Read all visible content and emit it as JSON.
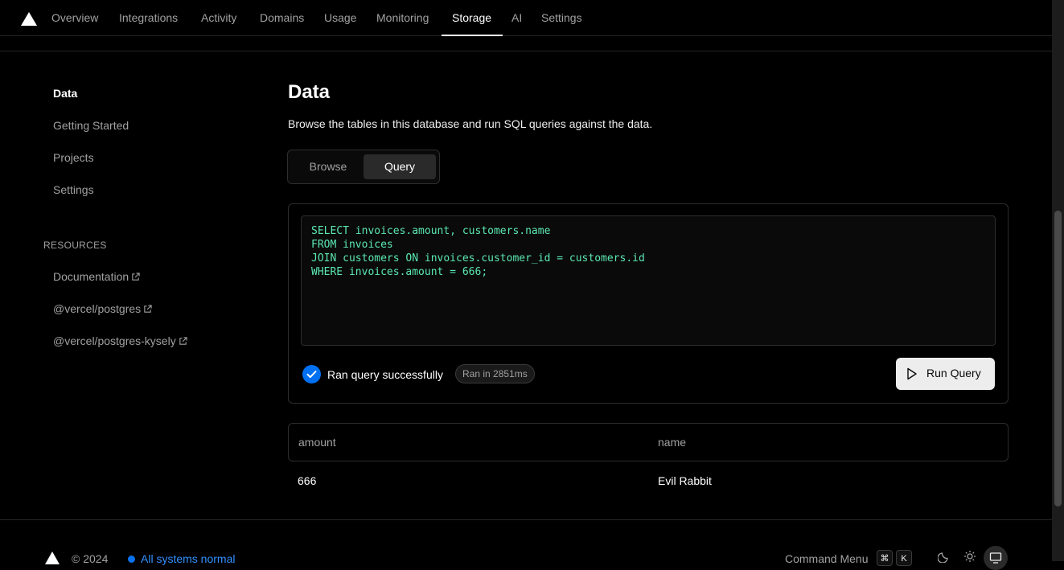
{
  "nav": {
    "tabs": [
      {
        "label": "Overview"
      },
      {
        "label": "Integrations"
      },
      {
        "label": "Activity"
      },
      {
        "label": "Domains"
      },
      {
        "label": "Usage"
      },
      {
        "label": "Monitoring"
      },
      {
        "label": "Storage",
        "active": true
      },
      {
        "label": "AI"
      },
      {
        "label": "Settings"
      }
    ]
  },
  "sidebar": {
    "items": [
      {
        "label": "Data",
        "active": true
      },
      {
        "label": "Getting Started"
      },
      {
        "label": "Projects"
      },
      {
        "label": "Settings"
      }
    ],
    "resources_heading": "RESOURCES",
    "resources": [
      {
        "label": "Documentation",
        "icon": "external-link-icon"
      },
      {
        "label": "@vercel/postgres",
        "icon": "external-link-icon"
      },
      {
        "label": "@vercel/postgres-kysely",
        "icon": "external-link-icon"
      }
    ]
  },
  "main": {
    "title": "Data",
    "description": "Browse the tables in this database and run SQL queries against the data.",
    "tabs": [
      {
        "label": "Browse"
      },
      {
        "label": "Query",
        "active": true
      }
    ],
    "query_lines": [
      "SELECT invoices.amount, customers.name",
      "FROM invoices",
      "JOIN customers ON invoices.customer_id = customers.id",
      "WHERE invoices.amount = 666;"
    ],
    "status_text": "Ran query successfully",
    "duration_badge": "Ran in 2851ms",
    "run_button_label": "Run Query",
    "results": {
      "columns": [
        "amount",
        "name"
      ],
      "rows": [
        [
          "666",
          "Evil Rabbit"
        ]
      ]
    }
  },
  "footer": {
    "copyright": "© 2024",
    "status": "All systems normal",
    "command_menu_label": "Command Menu",
    "shortcut_keys": [
      "⌘",
      "K"
    ]
  },
  "colors": {
    "accent_blue": "#0070f3",
    "code_green": "#5be8b3",
    "background": "#000000"
  }
}
